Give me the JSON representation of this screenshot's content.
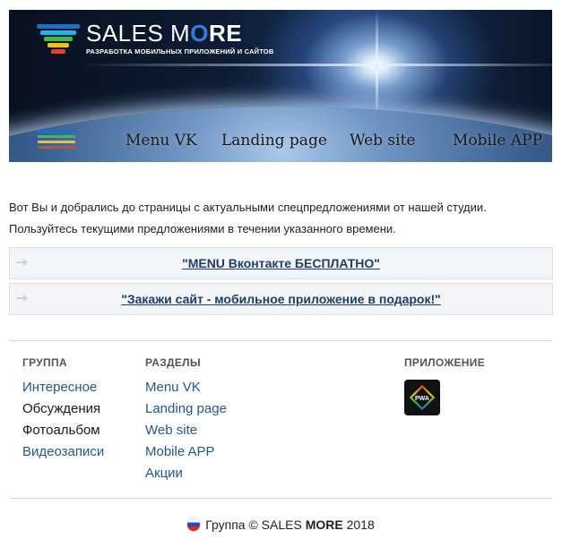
{
  "header": {
    "brand_light": "SALES M",
    "brand_accent": "O",
    "brand_end": "RE",
    "tagline": "РАЗРАБОТКА МОБИЛЬНЫХ ПРИЛОЖЕНИЙ И САЙТОВ",
    "nav": [
      "Menu VK",
      "Landing page",
      "Web site",
      "Mobile APP"
    ]
  },
  "intro_text": "Вот Вы и добрались до страницы с актуальными спецпредложениями от нашей студии. Пользуйтесь текущими предложениями в течении указанного времени.",
  "offers": [
    "\"MENU Вконтакте БЕСПЛАТНО\"",
    "\"Закажи сайт - мобильное приложение в подарок!\""
  ],
  "footer": {
    "group": {
      "heading": "ГРУППА",
      "links": [
        "Интересное",
        "Обсуждения",
        "Фотоальбом",
        "Видеозаписи"
      ]
    },
    "sections": {
      "heading": "РАЗДЕЛЫ",
      "links": [
        "Menu VK",
        "Landing page",
        "Web site",
        "Mobile APP",
        "Акции"
      ]
    },
    "app": {
      "heading": "ПРИЛОЖЕНИЕ",
      "icon_label": "PWA"
    },
    "copyright_prefix": "Группа © SALES ",
    "copyright_brand": "MORE",
    "copyright_year": " 2018"
  },
  "colors": {
    "link_blue": "#23578a",
    "offer_link": "#1d3f66",
    "brand_accent": "#2f7fe0",
    "funnel": [
      "#1a6fd4",
      "#1fb3e8",
      "#3fbf3f",
      "#f2c21b",
      "#e8402a"
    ]
  },
  "icons": [
    "menu-burger-icon",
    "arrow-right-icon",
    "pwa-app-icon",
    "russia-flag-icon"
  ]
}
